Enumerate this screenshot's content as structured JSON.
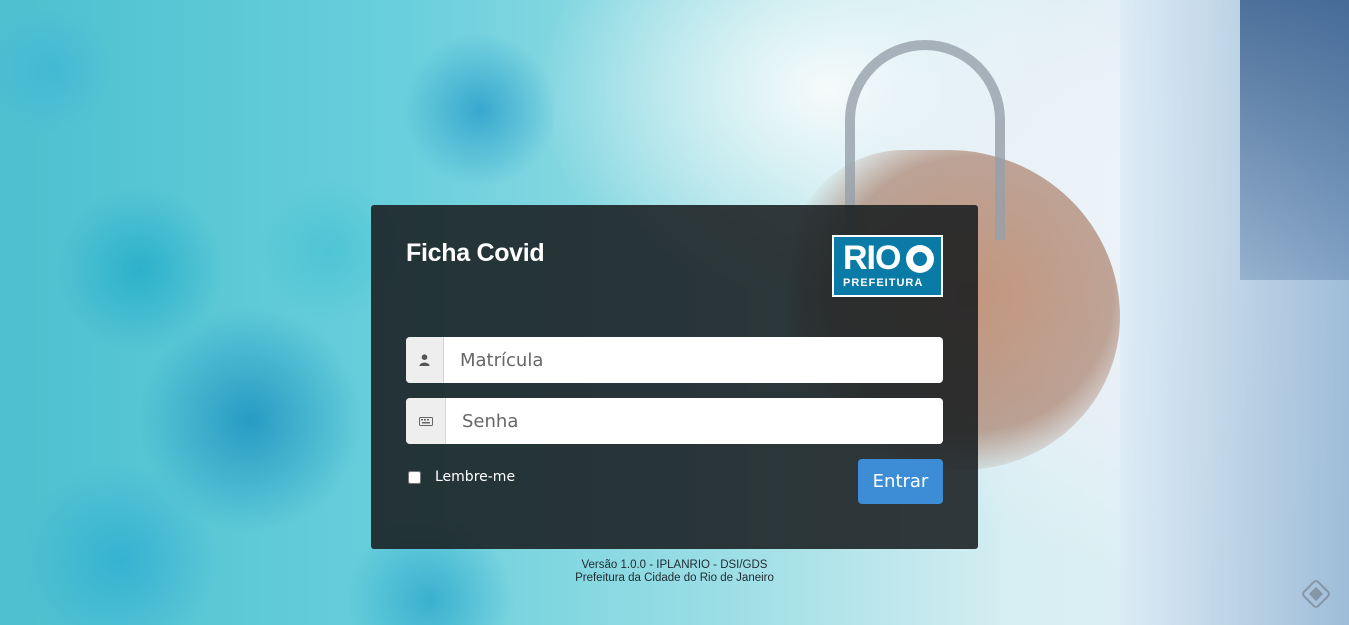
{
  "app": {
    "title": "Ficha Covid"
  },
  "logo": {
    "main_text": "RIO",
    "sub_text": "PREFEITURA",
    "brand_color": "#0a7aa6"
  },
  "form": {
    "username_placeholder": "Matrícula",
    "username_icon": "user-icon",
    "password_placeholder": "Senha",
    "password_icon": "keyboard-icon",
    "remember_label": "Lembre-me",
    "remember_checked": false,
    "submit_label": "Entrar",
    "submit_color": "#3c8dd6"
  },
  "footer": {
    "version_line": "Versão 1.0.0 - IPLANRIO - DSI/GDS",
    "org_line": "Prefeitura da Cidade do Rio de Janeiro"
  }
}
